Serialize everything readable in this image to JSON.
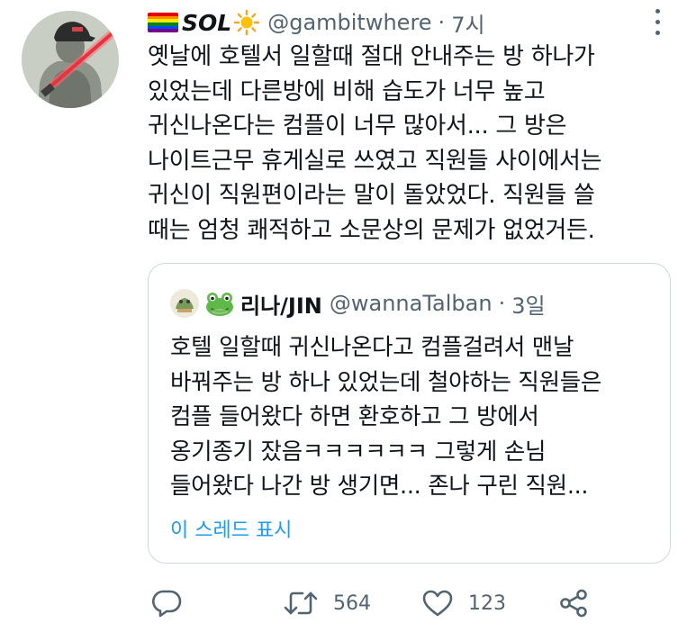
{
  "tweet": {
    "display_name": "SOL",
    "handle": "@gambitwhere",
    "separator": "·",
    "time": "7시",
    "lines": [
      "옛날에 호텔서 일할때 절대 안내주는 방 하나가",
      "있었는데 다른방에 비해 습도가 너무 높고",
      "귀신나온다는 컴플이 너무 많아서... 그 방은",
      "나이트근무 휴게실로 쓰였고 직원들 사이에서는",
      "귀신이 직원편이라는 말이 돌았었다. 직원들 쓸",
      "때는 엄청 쾌적하고 소문상의 문제가 없었거든."
    ]
  },
  "quote": {
    "display_name": "리나/JIN",
    "handle": "@wannaTalban",
    "separator": "·",
    "time": "3일",
    "lines": [
      "호텔 일할때 귀신나온다고 컴플걸려서 맨날",
      "바꿔주는 방 하나 있었는데 철야하는 직원들은",
      "컴플 들어왔다 하면 환호하고 그 방에서",
      "옹기종기 잤음ㅋㅋㅋㅋㅋㅋ 그렇게 손님",
      "들어왔다 나간 방 생기면... 존나 구린 직원..."
    ],
    "show_thread": "이 스레드 표시"
  },
  "actions": {
    "reply_icon": "reply-icon",
    "retweet_icon": "retweet-icon",
    "retweet_count": "564",
    "like_icon": "heart-icon",
    "like_count": "123",
    "share_icon": "share-icon"
  },
  "colors": {
    "text": "#0f1419",
    "secondary": "#536471",
    "link": "#1d9bf0",
    "border": "#cfd9de"
  }
}
